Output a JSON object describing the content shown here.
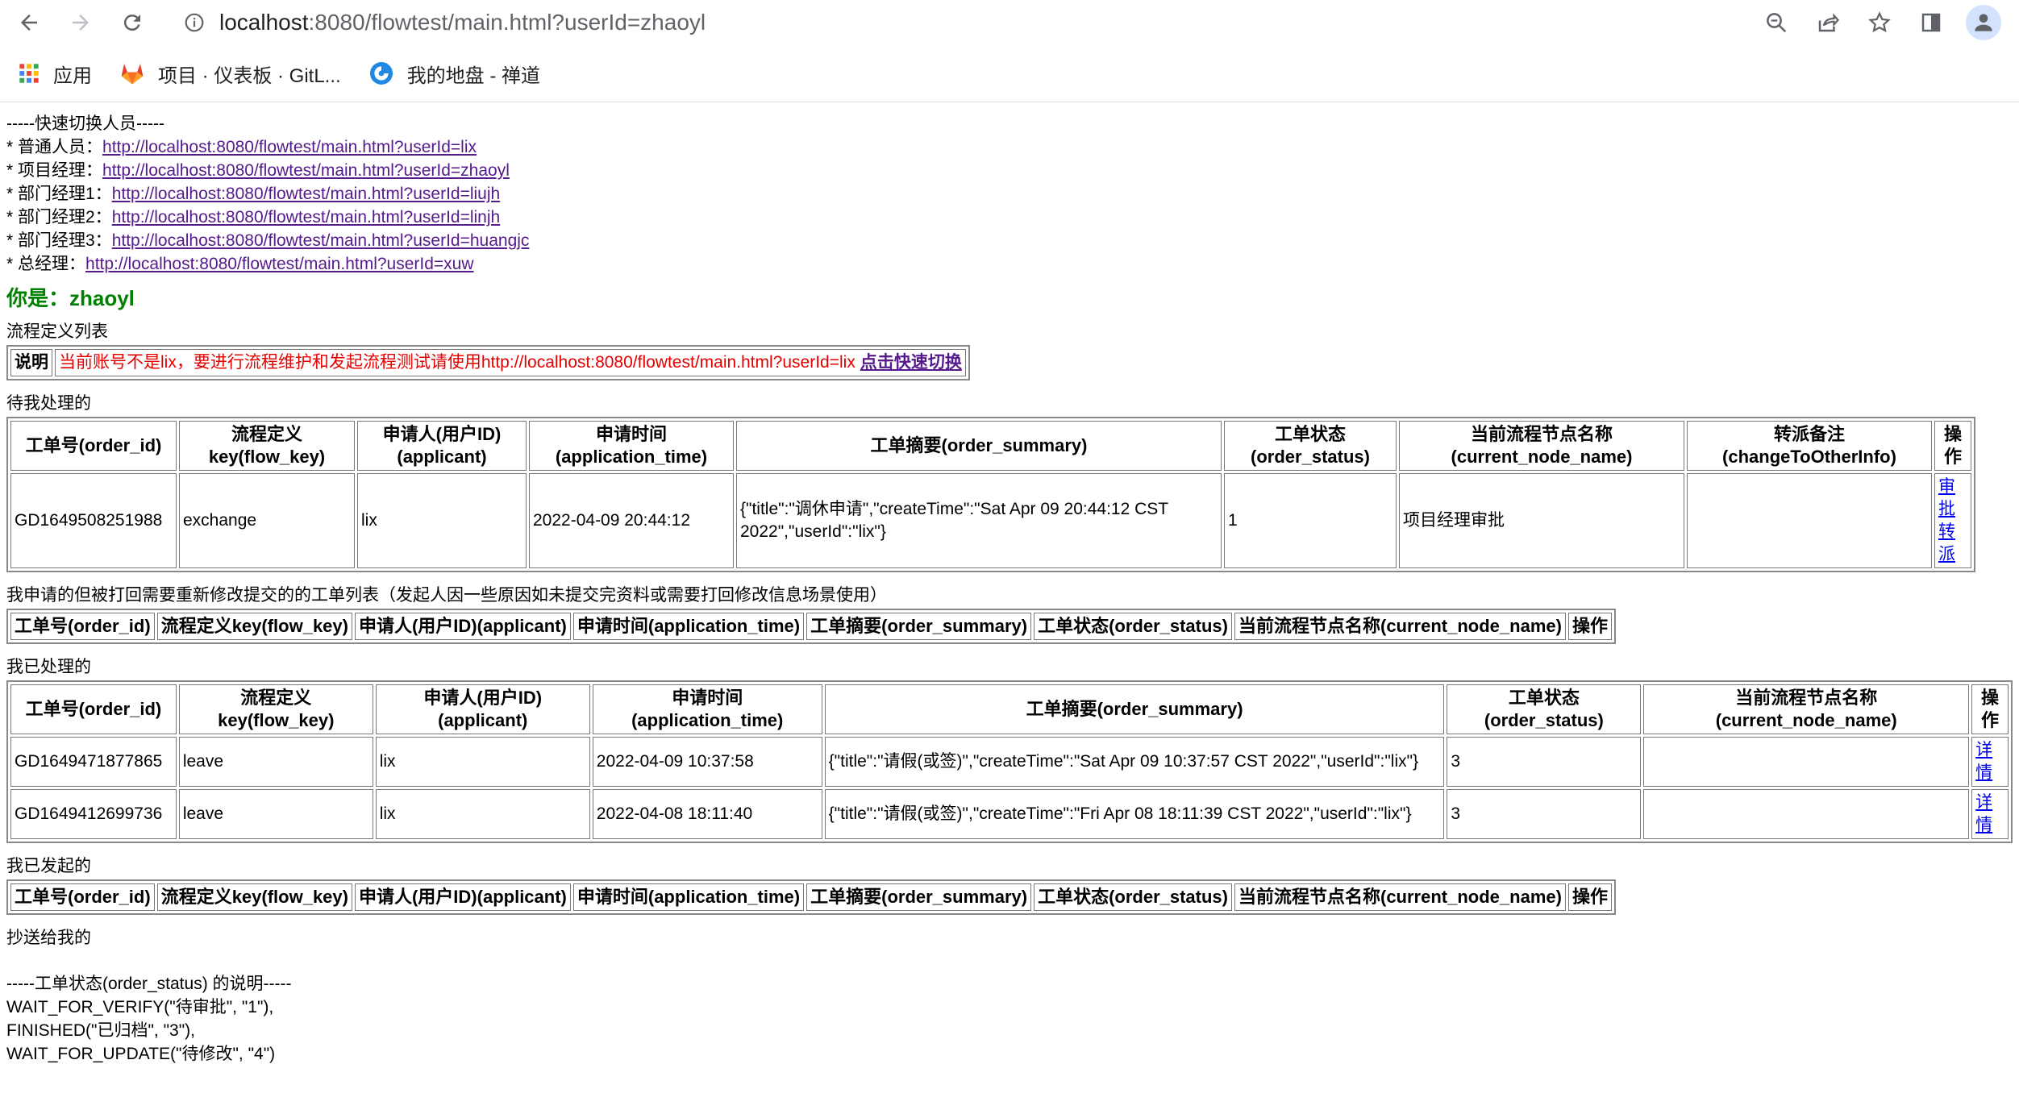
{
  "browser": {
    "url_host": "localhost",
    "url_path": ":8080/flowtest/main.html?userId=zhaoyl",
    "bookmarks": [
      {
        "label": "应用"
      },
      {
        "label": "项目 · 仪表板 · GitL..."
      },
      {
        "label": "我的地盘 - 禅道"
      }
    ]
  },
  "switch": {
    "header": "-----快速切换人员-----",
    "items": [
      {
        "label": "* 普通人员：",
        "url": "http://localhost:8080/flowtest/main.html?userId=lix"
      },
      {
        "label": "* 项目经理：",
        "url": "http://localhost:8080/flowtest/main.html?userId=zhaoyl"
      },
      {
        "label": "* 部门经理1：",
        "url": "http://localhost:8080/flowtest/main.html?userId=liujh"
      },
      {
        "label": "* 部门经理2：",
        "url": "http://localhost:8080/flowtest/main.html?userId=linjh"
      },
      {
        "label": "* 部门经理3：",
        "url": "http://localhost:8080/flowtest/main.html?userId=huangjc"
      },
      {
        "label": "* 总经理：",
        "url": "http://localhost:8080/flowtest/main.html?userId=xuw"
      }
    ]
  },
  "you": "你是：zhaoyl",
  "flowdef": {
    "title": "流程定义列表",
    "note_label": "说明",
    "note_text": "当前账号不是lix，要进行流程维护和发起流程测试请使用http://localhost:8080/flowtest/main.html?userId=lix",
    "note_link": "点击快速切换"
  },
  "todo": {
    "title": "待我处理的",
    "headers": [
      "工单号(order_id)",
      "流程定义key(flow_key)",
      "申请人(用户ID)(applicant)",
      "申请时间(application_time)",
      "工单摘要(order_summary)",
      "工单状态(order_status)",
      "当前流程节点名称(current_node_name)",
      "转派备注(changeToOtherInfo)",
      "操作"
    ],
    "rows": [
      {
        "order_id": "GD1649508251988",
        "flow_key": "exchange",
        "applicant": "lix",
        "time": "2022-04-09 20:44:12",
        "summary": "{\"title\":\"调休申请\",\"createTime\":\"Sat Apr 09 20:44:12 CST 2022\",\"userId\":\"lix\"}",
        "status": "1",
        "node": "项目经理审批",
        "remark": "",
        "op1": "审批",
        "op2": "转派"
      }
    ]
  },
  "rejected": {
    "title": "我申请的但被打回需要重新修改提交的的工单列表（发起人因一些原因如未提交完资料或需要打回修改信息场景使用）",
    "headers": [
      "工单号(order_id)",
      "流程定义key(flow_key)",
      "申请人(用户ID)(applicant)",
      "申请时间(application_time)",
      "工单摘要(order_summary)",
      "工单状态(order_status)",
      "当前流程节点名称(current_node_name)",
      "操作"
    ]
  },
  "done": {
    "title": "我已处理的",
    "headers": [
      "工单号(order_id)",
      "流程定义key(flow_key)",
      "申请人(用户ID)(applicant)",
      "申请时间(application_time)",
      "工单摘要(order_summary)",
      "工单状态(order_status)",
      "当前流程节点名称(current_node_name)",
      "操作"
    ],
    "rows": [
      {
        "order_id": "GD1649471877865",
        "flow_key": "leave",
        "applicant": "lix",
        "time": "2022-04-09 10:37:58",
        "summary": "{\"title\":\"请假(或签)\",\"createTime\":\"Sat Apr 09 10:37:57 CST 2022\",\"userId\":\"lix\"}",
        "status": "3",
        "node": "",
        "op": "详情"
      },
      {
        "order_id": "GD1649412699736",
        "flow_key": "leave",
        "applicant": "lix",
        "time": "2022-04-08 18:11:40",
        "summary": "{\"title\":\"请假(或签)\",\"createTime\":\"Fri Apr 08 18:11:39 CST 2022\",\"userId\":\"lix\"}",
        "status": "3",
        "node": "",
        "op": "详情"
      }
    ]
  },
  "started": {
    "title": "我已发起的",
    "headers": [
      "工单号(order_id)",
      "流程定义key(flow_key)",
      "申请人(用户ID)(applicant)",
      "申请时间(application_time)",
      "工单摘要(order_summary)",
      "工单状态(order_status)",
      "当前流程节点名称(current_node_name)",
      "操作"
    ]
  },
  "cc": {
    "title": "抄送给我的"
  },
  "status_note": {
    "header": "-----工单状态(order_status) 的说明-----",
    "lines": [
      "WAIT_FOR_VERIFY(\"待审批\", \"1\"),",
      "FINISHED(\"已归档\", \"3\"),",
      "WAIT_FOR_UPDATE(\"待修改\", \"4\")"
    ]
  }
}
